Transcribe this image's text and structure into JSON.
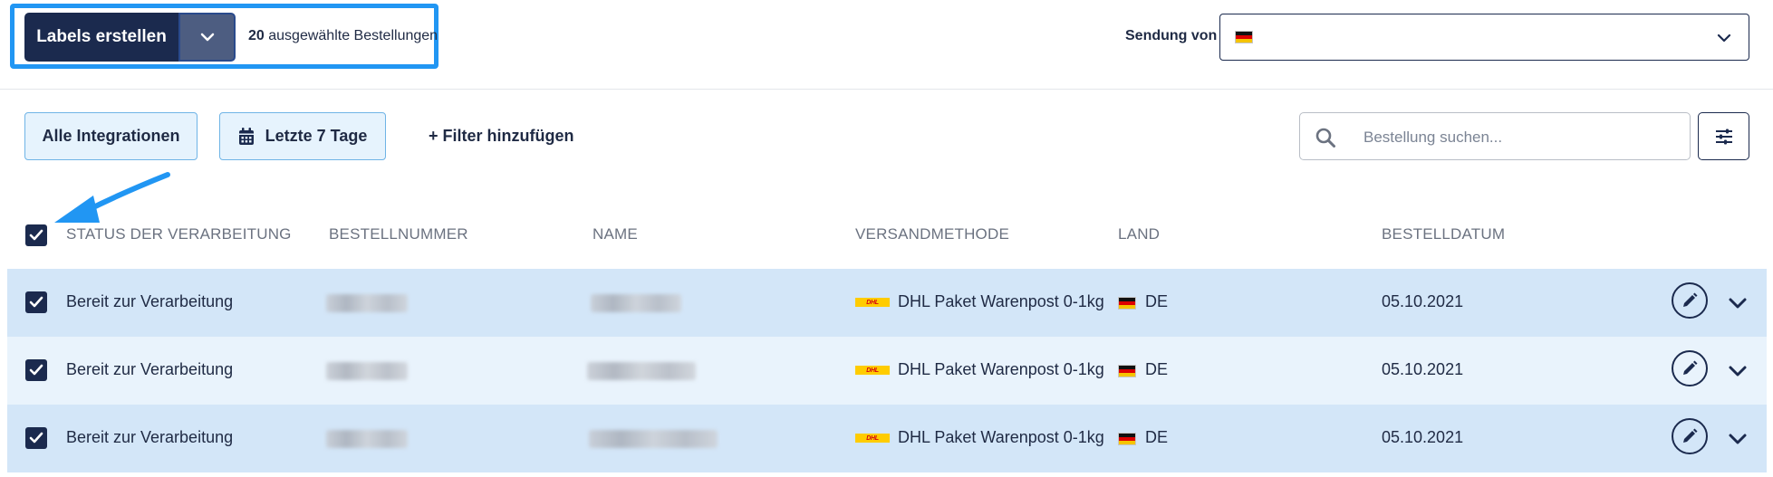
{
  "toolbar": {
    "create_labels": "Labels erstellen",
    "selected_count": "20",
    "selected_text": "ausgewählte Bestellungen",
    "sendung_von_label": "Sendung von"
  },
  "filters": {
    "integrations": "Alle Integrationen",
    "date_range": "Letzte 7 Tage",
    "add_filter": "+ Filter hinzufügen",
    "search_placeholder": "Bestellung suchen..."
  },
  "table": {
    "headers": {
      "status": "STATUS DER VERARBEITUNG",
      "order_number": "BESTELLNUMMER",
      "name": "NAME",
      "shipping_method": "VERSANDMETHODE",
      "country": "LAND",
      "order_date": "BESTELLDATUM"
    },
    "rows": [
      {
        "status": "Bereit zur Verarbeitung",
        "shipping": "DHL Paket Warenpost 0-1kg",
        "country": "DE",
        "date": "05.10.2021"
      },
      {
        "status": "Bereit zur Verarbeitung",
        "shipping": "DHL Paket Warenpost 0-1kg",
        "country": "DE",
        "date": "05.10.2021"
      },
      {
        "status": "Bereit zur Verarbeitung",
        "shipping": "DHL Paket Warenpost 0-1kg",
        "country": "DE",
        "date": "05.10.2021"
      }
    ]
  },
  "icons": {
    "dhl_logo_text": "DHL"
  },
  "colors": {
    "primary": "#1b2a4e",
    "highlight": "#2196f3",
    "row_dark": "#d3e6f8",
    "row_light": "#e9f3fc",
    "pill_bg": "#e6f3fd"
  }
}
